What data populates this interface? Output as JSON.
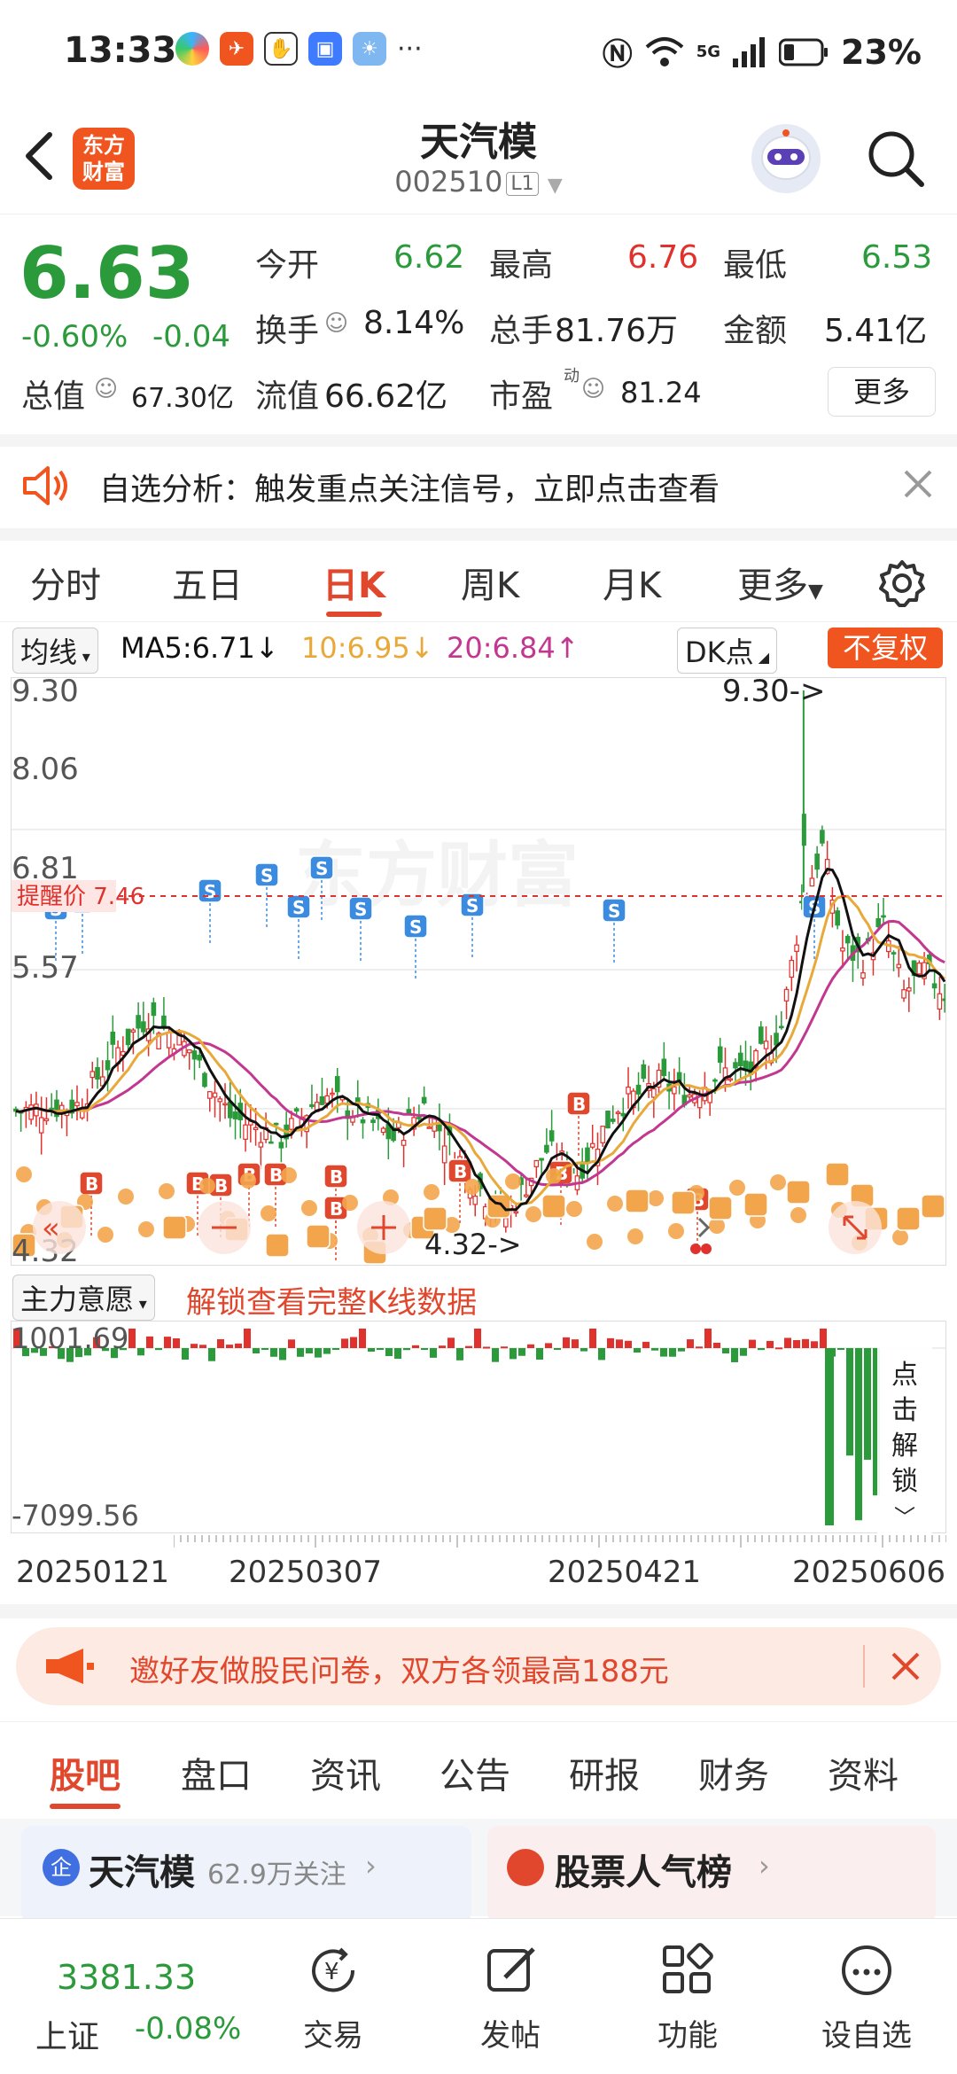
{
  "status_bar": {
    "time": "13:33",
    "more_dots": "···",
    "signal_label": "5G",
    "battery": "23%"
  },
  "header": {
    "logo_line1": "东方",
    "logo_line2": "财富",
    "stock_name": "天汽模",
    "stock_code": "002510",
    "level_badge": "L1"
  },
  "quote": {
    "price": "6.63",
    "change_pct": "-0.60%",
    "change_abs": "-0.04",
    "open_label": "今开",
    "open_value": "6.62",
    "high_label": "最高",
    "high_value": "6.76",
    "low_label": "最低",
    "low_value": "6.53",
    "turnover_label": "换手",
    "turnover_value": "8.14%",
    "volume_label": "总手",
    "volume_value": "81.76万",
    "amount_label": "金额",
    "amount_value": "5.41亿",
    "mktcap_label": "总值",
    "mktcap_value": "67.30亿",
    "float_label": "流值",
    "float_value": "66.62亿",
    "pe_label": "市盈",
    "pe_sup": "动",
    "pe_value": "81.24",
    "more_button": "更多"
  },
  "notice": {
    "text": "自选分析：触发重点关注信号，立即点击查看"
  },
  "chart_tabs": [
    "分时",
    "五日",
    "日K",
    "周K",
    "月K",
    "更多"
  ],
  "ma_row": {
    "selector": "均线",
    "ma5": "MA5:6.71↓",
    "ma10": "10:6.95↓",
    "ma20": "20:6.84↑",
    "dk": "DK点",
    "adjust": "不复权"
  },
  "kchart_labels": {
    "y_top": "9.30",
    "y_mid1": "8.06",
    "y_mid2": "6.81",
    "y_mid3": "5.57",
    "y_bottom": "4.32",
    "max_marker": "9.30->",
    "min_marker": "4.32->",
    "alert_label": "提醒价 7.46",
    "watermark": "东方财富"
  },
  "vol_header": {
    "selector": "主力意愿",
    "unlock_text": "解锁查看完整K线数据"
  },
  "vol_labels": {
    "y_top": "1001.69",
    "y_bottom": "-7099.56",
    "lock_text": [
      "点",
      "击",
      "解",
      "锁"
    ]
  },
  "dates": [
    "20250121",
    "20250307",
    "20250421",
    "20250606"
  ],
  "promo": {
    "text": "邀好友做股民问卷，双方各领最高188元"
  },
  "bottom_tabs": [
    "股吧",
    "盘口",
    "资讯",
    "公告",
    "研报",
    "财务",
    "资料"
  ],
  "cards": {
    "card1_badge": "企",
    "card1_title": "天汽模",
    "card1_follow": "62.9万关注",
    "card2_title": "股票人气榜"
  },
  "bottom_bar": {
    "index_value": "3381.33",
    "index_name": "上证",
    "index_change": "-0.08%",
    "trade": "交易",
    "post": "发帖",
    "functions": "功能",
    "add_watch": "设自选"
  },
  "colors": {
    "up": "#e0312d",
    "down": "#2a9a3b",
    "accent": "#f0541f",
    "ma5": "#111111",
    "ma10": "#e8a93a",
    "ma20": "#c2378f"
  },
  "icons": [
    "back-icon",
    "search-icon",
    "speaker-icon",
    "close-icon",
    "settings-icon",
    "megaphone-icon",
    "trade-icon",
    "post-icon",
    "functions-icon",
    "add-watch-icon"
  ]
}
